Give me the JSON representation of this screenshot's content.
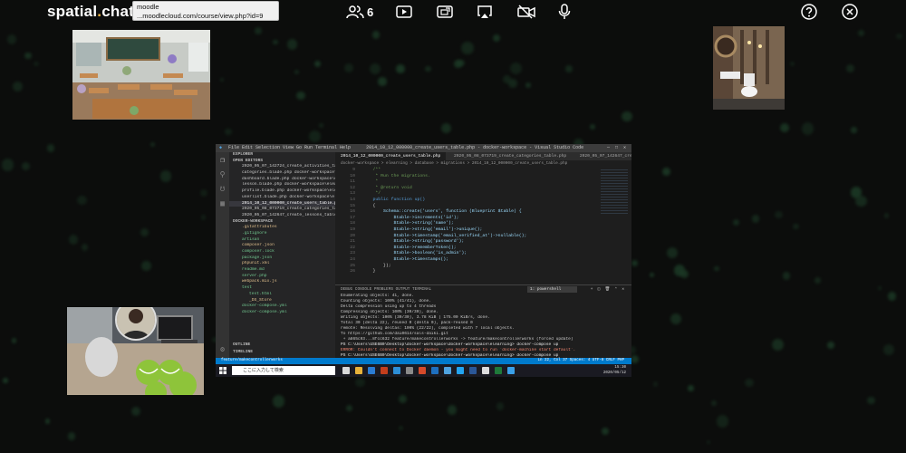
{
  "app": {
    "logo_main": "spatial",
    "logo_dot": ".",
    "logo_tail": "chat"
  },
  "tooltip": {
    "line1": "moodle",
    "line2": "...moodlecloud.com/course/view.php?id=9"
  },
  "toolbar": {
    "participants_count": "6",
    "icons": [
      "people-icon",
      "play-icon",
      "share-screen-icon",
      "airplay-icon",
      "camera-off-icon",
      "microphone-icon",
      "help-icon",
      "close-icon"
    ]
  },
  "vscode": {
    "title": "2014_10_12_000000_create_users_table.php - docker-workspace - Visual Studio Code",
    "menu": "File   Edit   Selection   View   Go   Run   Terminal   Help",
    "sidebar": {
      "explorer": "EXPLORER",
      "open_editors": "OPEN EDITORS",
      "open_files": [
        "2020_05_07_142724_create_activities_table.php",
        "categories.blade.php  docker-workspace\\elearning\\",
        "dashboard.blade.php  docker-workspace\\elearning\\",
        "lesson.blade.php  docker-workspace\\elearning\\",
        "profile.blade.php  docker-workspace\\elearning\\",
        "userlist.blade.php  docker-workspace\\elearning\\",
        "2014_10_12_000000_create_users_table.php  docker",
        "2020_05_08_073719_create_categories_table.php",
        "2020_05_07_142647_create_lessons_table.php"
      ],
      "workspace": "DOCKER-WORKSPACE",
      "files": [
        ".gitattributes",
        ".gitignore",
        "artisan",
        "composer.json",
        "composer.lock",
        "package.json",
        "phpunit.xml",
        "readme.md",
        "server.php",
        "webpack.mix.js",
        "test",
        "test.html",
        "_DS_Store",
        "docker-compose.yml",
        "docker-compose.yml"
      ],
      "outline": "OUTLINE",
      "timeline": "TIMELINE"
    },
    "tabs": [
      "2014_10_12_000000_create_users_table.php",
      "2020_05_08_073719_create_categories_table.php",
      "2020_05_07_142647_create_lesso"
    ],
    "breadcrumb": "docker-workspace > elearning > database > migrations > 2014_10_12_000000_create_users_table.php",
    "code": [
      {
        "n": "9",
        "t": "    /**"
      },
      {
        "n": "10",
        "t": "     * Run the migrations."
      },
      {
        "n": "11",
        "t": "     *"
      },
      {
        "n": "12",
        "t": "     * @return void"
      },
      {
        "n": "13",
        "t": "     */"
      },
      {
        "n": "14",
        "t": "    public function up()"
      },
      {
        "n": "15",
        "t": "    {"
      },
      {
        "n": "16",
        "t": "        Schema::create('users', function (Blueprint $table) {"
      },
      {
        "n": "17",
        "t": "            $table->increments('id');"
      },
      {
        "n": "18",
        "t": "            $table->string('name');"
      },
      {
        "n": "19",
        "t": "            $table->string('email')->unique();"
      },
      {
        "n": "20",
        "t": "            $table->timestamp('email_verified_at')->nullable();"
      },
      {
        "n": "21",
        "t": "            $table->string('password');"
      },
      {
        "n": "22",
        "t": "            $table->rememberToken();"
      },
      {
        "n": "23",
        "t": "            $table->boolean('is_admin');"
      },
      {
        "n": "24",
        "t": "            $table->timestamps();"
      },
      {
        "n": "25",
        "t": "        });"
      },
      {
        "n": "26",
        "t": "    }"
      }
    ],
    "panel_tabs": "DEBUG CONSOLE     PROBLEMS     OUTPUT     TERMINAL",
    "terminal_select": "1: powershell",
    "terminal": [
      "Enumerating objects: 41, done.",
      "Counting objects: 100% (41/41), done.",
      "Delta compression using up to 4 threads",
      "Compressing objects: 100% (30/30), done.",
      "Writing objects: 100% (30/30), 3.78 KiB | 175.00 KiB/s, done.",
      "Total 30 (delta 22), reused 0 (delta 0), pack-reused 0",
      "remote: Resolving deltas: 100% (22/22), completed with 7 local objects.",
      "To https://github.com/dai0614/sals-daiki.git",
      " + a865c93...8fcc632 feature/makecontrollerworks -> feature/makecontrollerworks (forced update)",
      "PS C:\\Users\\USE6B0\\Desktop\\docker-workspace\\docker-workspace\\elearning> docker-compose up",
      "ERROR: Couldn't connect to Docker daemon - you might need to run `docker-machine start default`.",
      "PS C:\\Users\\USE6B0\\Desktop\\docker-workspace\\docker-workspace\\elearning> docker-compose up"
    ],
    "status_left": "feature/makecontrollerworks",
    "status_right": "Ln 22, Col 37   Spaces: 4   UTF-8   CRLF   PHP",
    "taskbar_search": "ここに入力して検索",
    "clock_time": "15:30",
    "clock_date": "2020/05/12"
  }
}
